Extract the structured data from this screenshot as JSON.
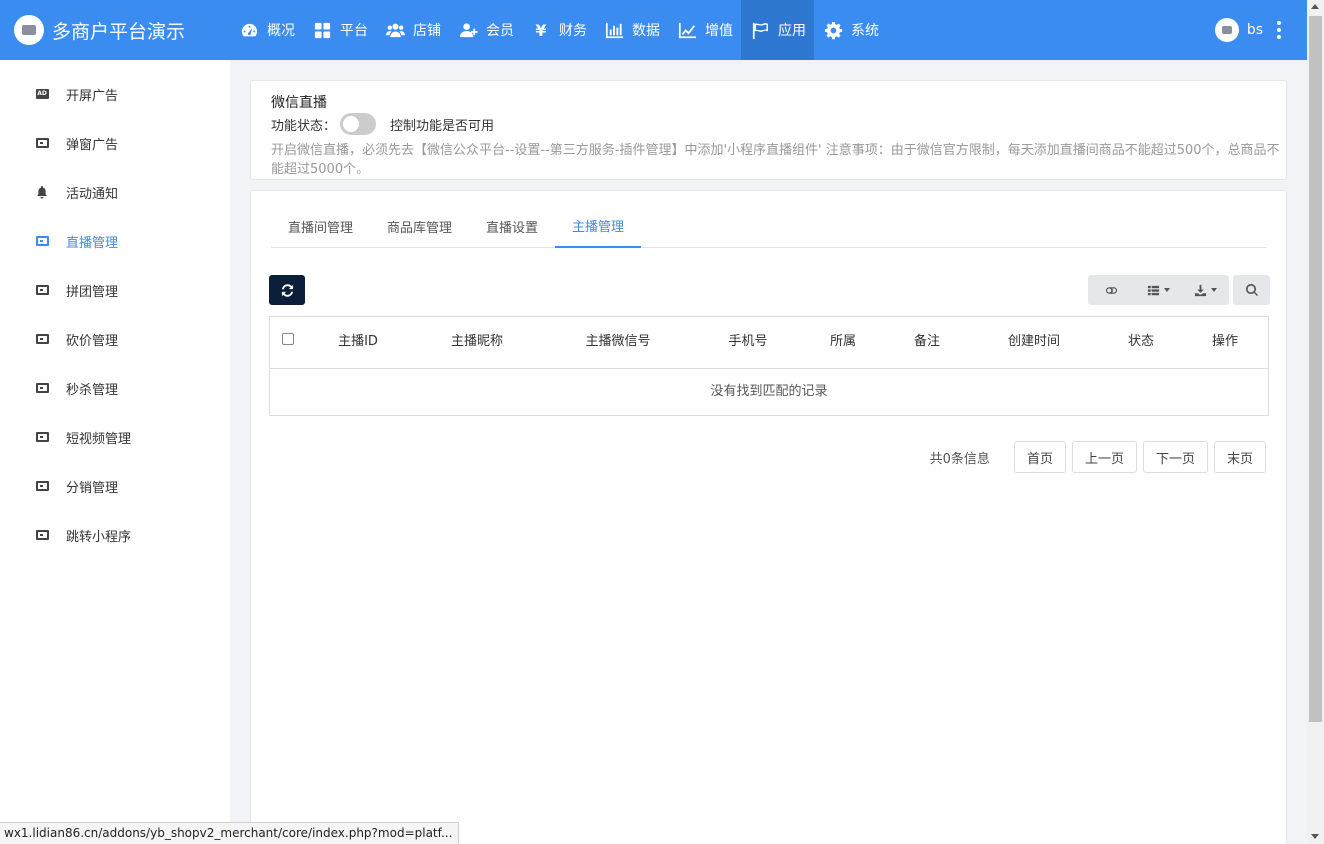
{
  "brand": {
    "title": "多商户平台演示"
  },
  "nav": [
    {
      "label": "概况",
      "icon": "dashboard-icon"
    },
    {
      "label": "平台",
      "icon": "grid-icon"
    },
    {
      "label": "店铺",
      "icon": "users-icon"
    },
    {
      "label": "会员",
      "icon": "user-plus-icon"
    },
    {
      "label": "财务",
      "icon": "yen-icon"
    },
    {
      "label": "数据",
      "icon": "bar-chart-icon"
    },
    {
      "label": "增值",
      "icon": "line-chart-icon"
    },
    {
      "label": "应用",
      "icon": "flag-icon",
      "active": true
    },
    {
      "label": "系统",
      "icon": "gear-icon"
    }
  ],
  "user": {
    "name": "bs"
  },
  "sidebar": {
    "items": [
      {
        "label": "开屏广告",
        "icon": "ad-icon"
      },
      {
        "label": "弹窗广告",
        "icon": "window-icon"
      },
      {
        "label": "活动通知",
        "icon": "bell-icon"
      },
      {
        "label": "直播管理",
        "icon": "window-icon",
        "active": true
      },
      {
        "label": "拼团管理",
        "icon": "window-icon"
      },
      {
        "label": "砍价管理",
        "icon": "window-icon"
      },
      {
        "label": "秒杀管理",
        "icon": "window-icon"
      },
      {
        "label": "短视频管理",
        "icon": "window-icon"
      },
      {
        "label": "分销管理",
        "icon": "window-icon"
      },
      {
        "label": "跳转小程序",
        "icon": "window-icon"
      }
    ]
  },
  "settings": {
    "title": "微信直播",
    "status_label": "功能状态：",
    "toggle_on": false,
    "status_desc": "控制功能是否可用",
    "notice": "开启微信直播，必须先去【微信公众平台--设置--第三方服务-插件管理】中添加'小程序直播组件' 注意事项：由于微信官方限制，每天添加直播间商品不能超过500个，总商品不能超过5000个。"
  },
  "tabs": [
    {
      "label": "直播间管理"
    },
    {
      "label": "商品库管理"
    },
    {
      "label": "直播设置"
    },
    {
      "label": "主播管理",
      "active": true
    }
  ],
  "table": {
    "columns": [
      "主播ID",
      "主播昵称",
      "主播微信号",
      "手机号",
      "所属",
      "备注",
      "创建时间",
      "状态",
      "操作"
    ],
    "empty_text": "没有找到匹配的记录"
  },
  "pager": {
    "info": "共0条信息",
    "first": "首页",
    "prev": "上一页",
    "next": "下一页",
    "last": "末页"
  },
  "statusbar": {
    "url": "wx1.lidian86.cn/addons/yb_shopv2_merchant/core/index.php?mod=platf..."
  },
  "colors": {
    "accent": "#3b8cf0",
    "topbar": "#3b8cf0",
    "dark_button": "#0b1f3a"
  }
}
